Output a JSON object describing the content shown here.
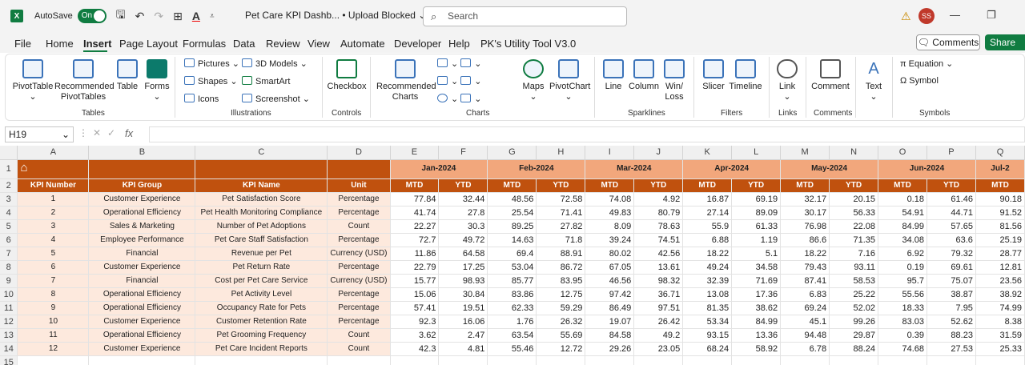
{
  "titlebar": {
    "logo": "X",
    "autosave_label": "AutoSave",
    "autosave_state": "On",
    "doc_title": "Pet Care KPI Dashb...  • Upload Blocked ⌄",
    "search_placeholder": "Search",
    "user_initials": "SS"
  },
  "menu": [
    "File",
    "Home",
    "Insert",
    "Page Layout",
    "Formulas",
    "Data",
    "Review",
    "View",
    "Automate",
    "Developer",
    "Help",
    "PK's Utility Tool V3.0"
  ],
  "active_tab": "Insert",
  "comments_label": "Comments",
  "share_label": "Share",
  "ribbon": {
    "tables": {
      "group": "Tables",
      "pivot": "PivotTable",
      "rec_pivot_1": "Recommended",
      "rec_pivot_2": "PivotTables",
      "table": "Table",
      "forms": "Forms"
    },
    "illustrations": {
      "group": "Illustrations",
      "pictures": "Pictures",
      "shapes": "Shapes",
      "icons": "Icons",
      "models": "3D Models",
      "smartart": "SmartArt",
      "screenshot": "Screenshot"
    },
    "controls": {
      "group": "Controls",
      "checkbox": "Checkbox"
    },
    "charts": {
      "group": "Charts",
      "rec_1": "Recommended",
      "rec_2": "Charts",
      "maps": "Maps",
      "pivotchart": "PivotChart"
    },
    "sparklines": {
      "group": "Sparklines",
      "line": "Line",
      "column": "Column",
      "winloss_1": "Win/",
      "winloss_2": "Loss"
    },
    "filters": {
      "group": "Filters",
      "slicer": "Slicer",
      "timeline": "Timeline"
    },
    "links": {
      "group": "Links",
      "link": "Link"
    },
    "comments": {
      "group": "Comments",
      "comment": "Comment"
    },
    "text": {
      "text": "Text"
    },
    "symbols": {
      "group": "Symbols",
      "equation": "Equation",
      "symbol": "Symbol"
    }
  },
  "formula_bar": {
    "name_box": "H19",
    "fx": "fx",
    "value": ""
  },
  "sheet": {
    "col_letters": [
      "A",
      "B",
      "C",
      "D",
      "E",
      "F",
      "G",
      "H",
      "I",
      "J",
      "K",
      "L",
      "M",
      "N",
      "O",
      "P",
      "Q"
    ],
    "months": [
      "Jan-2024",
      "Feb-2024",
      "Mar-2024",
      "Apr-2024",
      "May-2024",
      "Jun-2024",
      "Jul-2"
    ],
    "headers": {
      "kpi_number": "KPI Number",
      "kpi_group": "KPI Group",
      "kpi_name": "KPI Name",
      "unit": "Unit",
      "mtd": "MTD",
      "ytd": "YTD"
    },
    "rows": [
      {
        "n": "1",
        "group": "Customer Experience",
        "name": "Pet Satisfaction Score",
        "unit": "Percentage",
        "v": [
          "77.84",
          "32.44",
          "48.56",
          "72.58",
          "74.08",
          "4.92",
          "16.87",
          "69.19",
          "32.17",
          "20.15",
          "0.18",
          "61.46",
          "90.18"
        ]
      },
      {
        "n": "2",
        "group": "Operational Efficiency",
        "name": "Pet Health Monitoring Compliance",
        "unit": "Percentage",
        "v": [
          "41.74",
          "27.8",
          "25.54",
          "71.41",
          "49.83",
          "80.79",
          "27.14",
          "89.09",
          "30.17",
          "56.33",
          "54.91",
          "44.71",
          "91.52"
        ]
      },
      {
        "n": "3",
        "group": "Sales & Marketing",
        "name": "Number of Pet Adoptions",
        "unit": "Count",
        "v": [
          "22.27",
          "30.3",
          "89.25",
          "27.82",
          "8.09",
          "78.63",
          "55.9",
          "61.33",
          "76.98",
          "22.08",
          "84.99",
          "57.65",
          "81.56"
        ]
      },
      {
        "n": "4",
        "group": "Employee Performance",
        "name": "Pet Care Staff Satisfaction",
        "unit": "Percentage",
        "v": [
          "72.7",
          "49.72",
          "14.63",
          "71.8",
          "39.24",
          "74.51",
          "6.88",
          "1.19",
          "86.6",
          "71.35",
          "34.08",
          "63.6",
          "25.19"
        ]
      },
      {
        "n": "5",
        "group": "Financial",
        "name": "Revenue per Pet",
        "unit": "Currency (USD)",
        "v": [
          "11.86",
          "64.58",
          "69.4",
          "88.91",
          "80.02",
          "42.56",
          "18.22",
          "5.1",
          "18.22",
          "7.16",
          "6.92",
          "79.32",
          "28.77"
        ]
      },
      {
        "n": "6",
        "group": "Customer Experience",
        "name": "Pet Return Rate",
        "unit": "Percentage",
        "v": [
          "22.79",
          "17.25",
          "53.04",
          "86.72",
          "67.05",
          "13.61",
          "49.24",
          "34.58",
          "79.43",
          "93.11",
          "0.19",
          "69.61",
          "12.81"
        ]
      },
      {
        "n": "7",
        "group": "Financial",
        "name": "Cost per Pet Care Service",
        "unit": "Currency (USD)",
        "v": [
          "15.77",
          "98.93",
          "85.77",
          "83.95",
          "46.56",
          "98.32",
          "32.39",
          "71.69",
          "87.41",
          "58.53",
          "95.7",
          "75.07",
          "23.56"
        ]
      },
      {
        "n": "8",
        "group": "Operational Efficiency",
        "name": "Pet Activity Level",
        "unit": "Percentage",
        "v": [
          "15.06",
          "30.84",
          "83.86",
          "12.75",
          "97.42",
          "36.71",
          "13.08",
          "17.36",
          "6.83",
          "25.22",
          "55.56",
          "38.87",
          "38.92"
        ]
      },
      {
        "n": "9",
        "group": "Operational Efficiency",
        "name": "Occupancy Rate for Pets",
        "unit": "Percentage",
        "v": [
          "57.41",
          "19.51",
          "62.33",
          "59.29",
          "86.49",
          "97.51",
          "81.35",
          "38.62",
          "69.24",
          "52.02",
          "18.33",
          "7.95",
          "74.99"
        ]
      },
      {
        "n": "10",
        "group": "Customer Experience",
        "name": "Customer Retention Rate",
        "unit": "Percentage",
        "v": [
          "92.3",
          "16.06",
          "1.76",
          "26.32",
          "19.07",
          "26.42",
          "53.34",
          "84.99",
          "45.1",
          "99.26",
          "83.03",
          "52.62",
          "8.38"
        ]
      },
      {
        "n": "11",
        "group": "Operational Efficiency",
        "name": "Pet Grooming Frequency",
        "unit": "Count",
        "v": [
          "3.62",
          "2.47",
          "63.54",
          "55.69",
          "84.58",
          "49.2",
          "93.15",
          "13.36",
          "94.48",
          "29.87",
          "0.39",
          "88.23",
          "31.59"
        ]
      },
      {
        "n": "12",
        "group": "Customer Experience",
        "name": "Pet Care Incident Reports",
        "unit": "Count",
        "v": [
          "42.3",
          "4.81",
          "55.46",
          "12.72",
          "29.26",
          "23.05",
          "68.24",
          "58.92",
          "6.78",
          "88.24",
          "74.68",
          "27.53",
          "25.33"
        ]
      }
    ]
  }
}
